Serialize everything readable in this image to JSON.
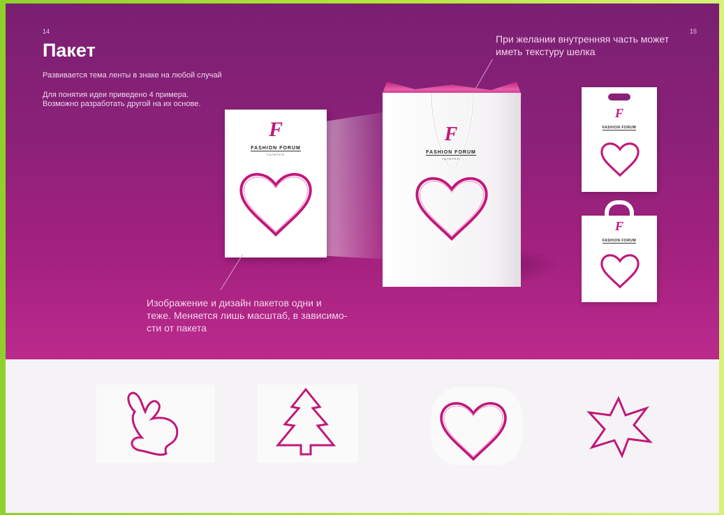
{
  "page_numbers": {
    "left": "14",
    "right": "15"
  },
  "title": "Пакет",
  "subtitle_1": "Развивается тема ленты в знаке на любой случай",
  "subtitle_2_line1": "Для понятия идеи приведено 4 примера.",
  "subtitle_2_line2": "Возможно разработать другой на их основе.",
  "callout_top_line1": "При желании внутренняя часть может",
  "callout_top_line2": "иметь текстуру шелка",
  "callout_bottom_line1": "Изображение и дизайн пакетов одни и",
  "callout_bottom_line2": "теже. Меняется лишь масштаб, в зависимо-",
  "callout_bottom_line3": "сти от пакета",
  "logo": {
    "letter": "F",
    "name": "FASHION FORUM",
    "sub": "ГАЛЕРЕЯ"
  },
  "colors": {
    "accent": "#c0187a",
    "top_bg": "#8a2178",
    "bottom_bg": "#f5f3f6"
  },
  "ribbon_shapes": [
    "bunny",
    "tree",
    "heart",
    "star"
  ]
}
